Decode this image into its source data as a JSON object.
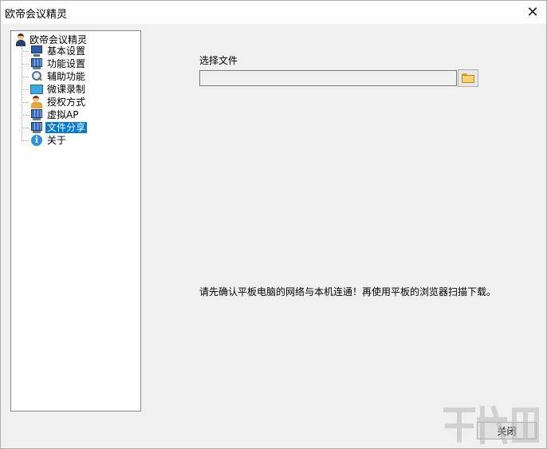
{
  "window": {
    "title": "欧帝会议精灵",
    "close_symbol": "✕"
  },
  "tree": {
    "root": {
      "label": "欧帝会议精灵",
      "icon": "person-icon"
    },
    "items": [
      {
        "label": "基本设置",
        "icon": "monitor-icon"
      },
      {
        "label": "功能设置",
        "icon": "grid-monitor-icon"
      },
      {
        "label": "辅助功能",
        "icon": "search-icon"
      },
      {
        "label": "微课录制",
        "icon": "video-icon"
      },
      {
        "label": "授权方式",
        "icon": "auth-icon"
      },
      {
        "label": "虚拟AP",
        "icon": "grid-monitor-icon"
      },
      {
        "label": "文件分享",
        "icon": "grid-monitor-icon",
        "selected": true
      },
      {
        "label": "关于",
        "icon": "info-icon"
      }
    ]
  },
  "file_share": {
    "select_label": "选择文件",
    "path_value": "",
    "notice": "请先确认平板电脑的网络与本机连通！再使用平板的浏览器扫描下载。"
  },
  "footer": {
    "close_label": "关闭"
  },
  "colors": {
    "selection": "#0078d7",
    "background": "#f0f0f0"
  }
}
